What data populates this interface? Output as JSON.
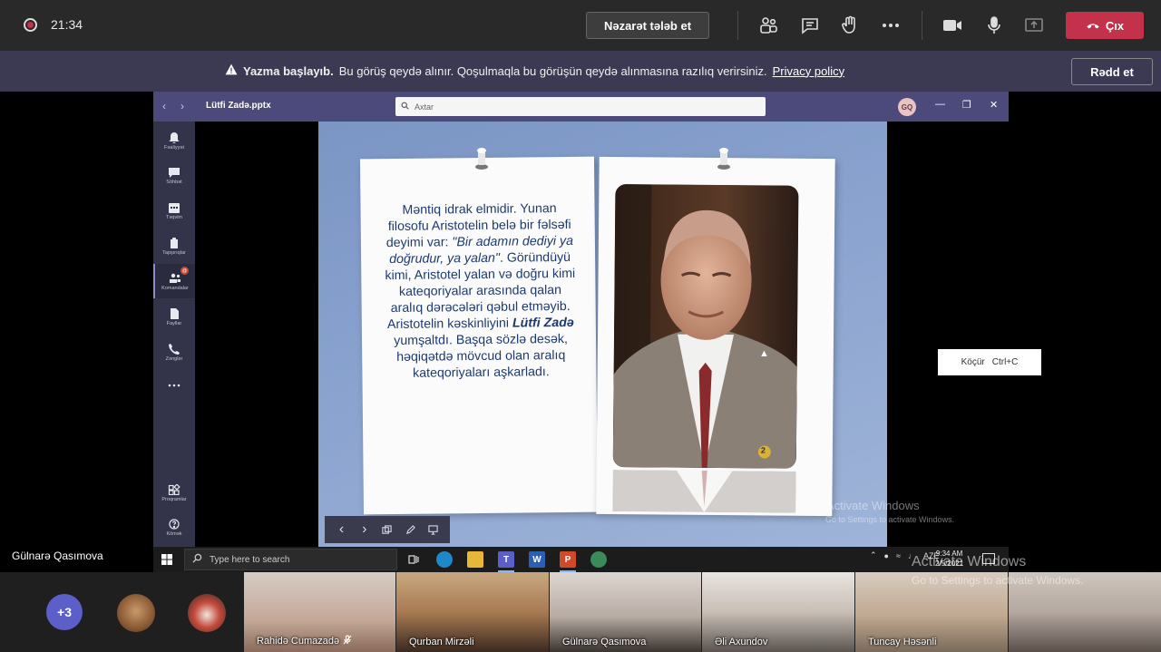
{
  "call": {
    "timer": "21:34",
    "request_control_label": "Nəzarət tələb et",
    "leave_label": "Çıx"
  },
  "banner": {
    "title": "Yazma başlayıb.",
    "message": "Bu görüş qeydə alınır. Qoşulmaqla bu görüşün qeydə alınmasına razılıq verirsiniz.",
    "link": "Privacy policy",
    "dismiss_label": "Rədd et"
  },
  "shared_window": {
    "title": "Lütfi Zadə.pptx",
    "search_placeholder": "Axtar",
    "avatar_initials": "GQ",
    "rail": [
      {
        "label": "Fəaliyyət",
        "icon": "bell-icon"
      },
      {
        "label": "Söhbət",
        "icon": "chat-icon"
      },
      {
        "label": "Təqvim",
        "icon": "calendar-icon"
      },
      {
        "label": "Tapşırıqlar",
        "icon": "assignments-icon"
      },
      {
        "label": "Komandalar",
        "icon": "teams-icon",
        "badge": "@"
      },
      {
        "label": "Fayllar",
        "icon": "files-icon"
      },
      {
        "label": "Zənglər",
        "icon": "phone-icon"
      },
      {
        "label": "Proqramlar",
        "icon": "apps-icon"
      },
      {
        "label": "Kömək",
        "icon": "help-icon"
      }
    ]
  },
  "slide": {
    "lines": {
      "p1": "Məntiq idrak elmidir. Yunan filosofu Aristotelin belə bir fəlsəfi deyimi var: ",
      "quote": "\"Bir adamın dediyi ya doğrudur, ya yalan\"",
      "p2": ". Göründüyü kimi, Aristotel yalan və doğru kimi kateqoriyalar arasında qalan aralıq dərəcələri qəbul etməyib. Aristotelin kəskinliyini ",
      "name": "Lütfi Zadə",
      "p3": " yumşaltdı. Başqa sözlə desək, həqiqətdə mövcud olan aralıq kateqoriyaları aşkarladı."
    },
    "page_number": "2"
  },
  "tooltip": {
    "action": "Köçür",
    "shortcut": "Ctrl+C"
  },
  "watermark": {
    "title": "Activate Windows",
    "subtitle": "Go to Settings to activate Windows."
  },
  "presenter_name": "Gülnarə Qasımova",
  "taskbar": {
    "search_placeholder": "Type here to search",
    "lang": "AZE",
    "time": "9:34 AM",
    "date": "2/5/2021"
  },
  "participants": {
    "more_count": "+3",
    "tiles": [
      {
        "name": "Rahidə Cumazadə",
        "muted": true
      },
      {
        "name": "Qurban Mirzəli",
        "muted": false
      },
      {
        "name": "Gülnarə Qasımova",
        "muted": false
      },
      {
        "name": "Əli Axundov",
        "muted": false
      },
      {
        "name": "Tuncay Həsənli",
        "muted": false
      },
      {
        "name": "",
        "muted": false
      }
    ]
  },
  "colors": {
    "leave": "#c4314b",
    "banner": "#3b3a52",
    "teams_purple": "#4b4a7a",
    "slide_text": "#1d3a6e"
  }
}
